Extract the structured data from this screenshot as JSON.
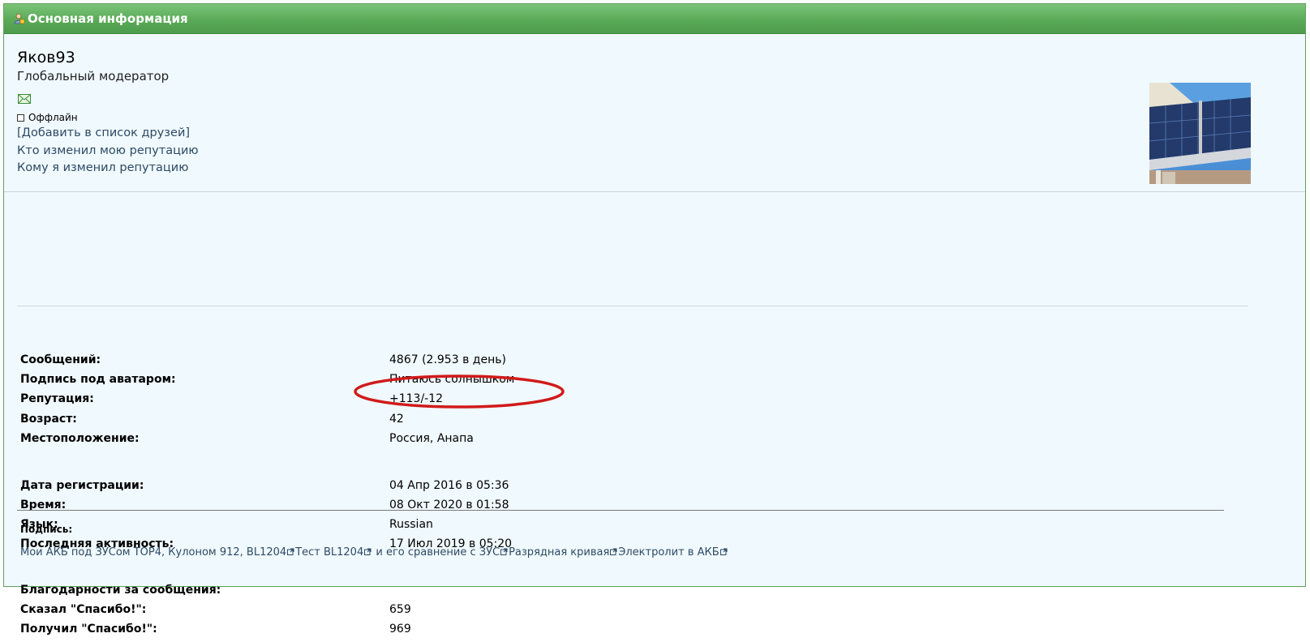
{
  "header": {
    "title": "Основная информация",
    "icon": "user-profile-icon"
  },
  "profile": {
    "username": "Яков93",
    "rank": "Глобальный модератор",
    "status": "Оффлайн",
    "links": {
      "add_friend": "[Добавить в список друзей]",
      "who_changed_rep": "Кто изменил мою репутацию",
      "whom_changed_rep": "Кому я изменил репутацию"
    }
  },
  "stats": {
    "messages_label": "Сообщений:",
    "messages_value": "4867 (2.953 в день)",
    "signature_label": "Подпись под аватаром:",
    "signature_value": "Питаюсь солнышком",
    "reputation_label": "Репутация:",
    "reputation_value": "+113/-12",
    "age_label": "Возраст:",
    "age_value": "42",
    "location_label": "Местоположение:",
    "location_value": "Россия, Анапа",
    "reg_label": "Дата регистрации:",
    "reg_value": "04 Апр 2016 в 05:36",
    "time_label": "Время:",
    "time_value": "08 Окт 2020 в 01:58",
    "lang_label": "Язык:",
    "lang_value": "Russian",
    "last_label": "Последняя активность:",
    "last_value": "17 Июл 2019 в 05:20",
    "thanks_label": "Благодарности за сообщения:",
    "said_label": "Сказал \"Спасибо!\":",
    "said_value": "659",
    "got_label": "Получил \"Спасибо!\":",
    "got_value": "969"
  },
  "signature": {
    "title": "Подпись:",
    "link1": "Мои АКБ под ЗУСом TOP4, Кулоном 912, BL1204",
    "link2": "Тест BL1204",
    "link3": " и его сравнение с ЗУС",
    "link4": "Разрядная кривая",
    "link5": "Электролит в АКБ"
  },
  "colors": {
    "header_green": "#5aaa57",
    "panel_bg": "#f0f9fd",
    "link": "#2d4a66",
    "highlight_oval": "#d11a1a"
  }
}
